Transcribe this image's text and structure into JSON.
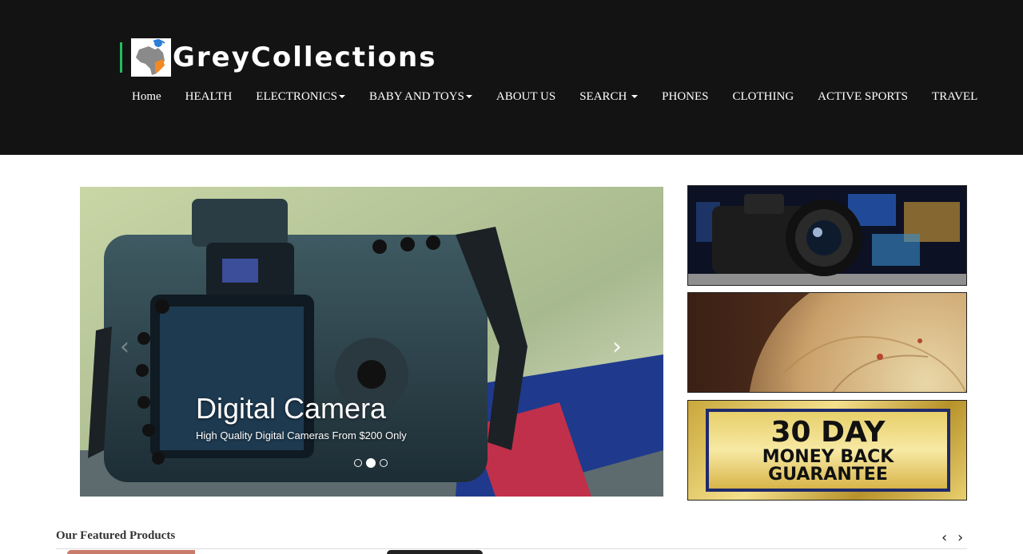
{
  "brand": {
    "name": "GreyCollections",
    "accent_color": "#1fbf5a"
  },
  "nav": {
    "items": [
      {
        "label": "Home",
        "dropdown": false
      },
      {
        "label": "HEALTH",
        "dropdown": false
      },
      {
        "label": "ELECTRONICS",
        "dropdown": true
      },
      {
        "label": "BABY AND TOYS",
        "dropdown": true
      },
      {
        "label": "ABOUT US",
        "dropdown": false
      },
      {
        "label": "SEARCH ",
        "dropdown": true
      },
      {
        "label": "PHONES",
        "dropdown": false
      },
      {
        "label": "CLOTHING",
        "dropdown": false
      },
      {
        "label": "ACTIVE SPORTS",
        "dropdown": false
      },
      {
        "label": "TRAVEL",
        "dropdown": false
      }
    ]
  },
  "hero": {
    "title": "Digital Camera",
    "subtitle": "High Quality Digital Cameras From $200 Only",
    "prev_icon": "chevron-left-icon",
    "next_icon": "chevron-right-icon",
    "slide_count": 3,
    "active_slide": 2
  },
  "side_banners": {
    "guarantee": {
      "line1": "30 DAY",
      "line2": "MONEY BACK",
      "line3": "GUARANTEE"
    }
  },
  "featured": {
    "title": "Our Featured Products",
    "prev_icon": "chevron-left-icon",
    "next_icon": "chevron-right-icon"
  },
  "colors": {
    "header_bg": "#131313",
    "page_bg": "#ffffff"
  }
}
